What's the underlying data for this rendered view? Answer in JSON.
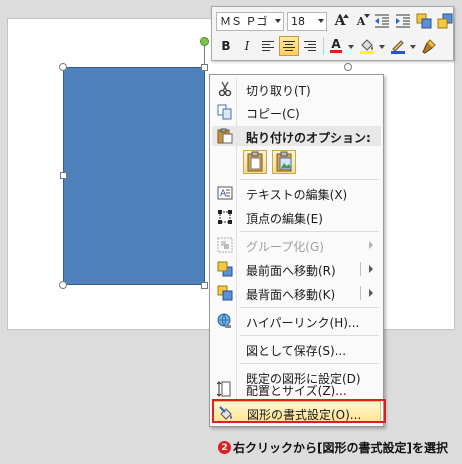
{
  "colors": {
    "shape_fill": "#4f81bd",
    "highlight": "#ffe594",
    "callout_red": "#e02020",
    "font_color_bar": "#e02020",
    "highlight_bar": "#ffff00",
    "outline_bar": "#2255cc"
  },
  "mini_toolbar": {
    "font_name": "ＭＳ Ｐゴ",
    "font_size": "18",
    "row1_buttons": [
      {
        "name": "grow-font-icon",
        "label": "A"
      },
      {
        "name": "shrink-font-icon",
        "label": "A"
      },
      {
        "name": "decrease-indent-icon"
      },
      {
        "name": "increase-indent-icon"
      },
      {
        "name": "arrange-icon"
      },
      {
        "name": "bring-forward-icon"
      }
    ],
    "row2": {
      "bold": "B",
      "italic": "I",
      "font_color": "A"
    }
  },
  "context_menu": {
    "items": [
      {
        "label": "切り取り(T)",
        "icon": "scissors-icon"
      },
      {
        "label": "コピー(C)",
        "icon": "copy-icon"
      }
    ],
    "paste_header": "貼り付けのオプション:",
    "paste_options": [
      "paste-keep-icon",
      "paste-picture-icon"
    ],
    "items2": [
      {
        "label": "テキストの編集(X)",
        "icon": "edit-text-icon"
      },
      {
        "label": "頂点の編集(E)",
        "icon": "edit-points-icon"
      }
    ],
    "items3": [
      {
        "label": "グループ化(G)",
        "icon": "group-icon",
        "disabled": true,
        "submenu": true
      },
      {
        "label": "最前面へ移動(R)",
        "icon": "bring-front-icon",
        "submenu": true
      },
      {
        "label": "最背面へ移動(K)",
        "icon": "send-back-icon",
        "submenu": true
      }
    ],
    "items4": [
      {
        "label": "ハイパーリンク(H)...",
        "icon": "hyperlink-icon"
      }
    ],
    "items5": [
      {
        "label": "図として保存(S)..."
      }
    ],
    "items6": [
      {
        "label": "既定の図形に設定(D)"
      },
      {
        "label": "配置とサイズ(Z)...",
        "icon": "size-position-icon"
      },
      {
        "label": "図形の書式設定(O)...",
        "icon": "format-shape-icon"
      }
    ]
  },
  "caption": {
    "number": "②",
    "text": "右クリックから[図形の書式設定]を選択"
  }
}
